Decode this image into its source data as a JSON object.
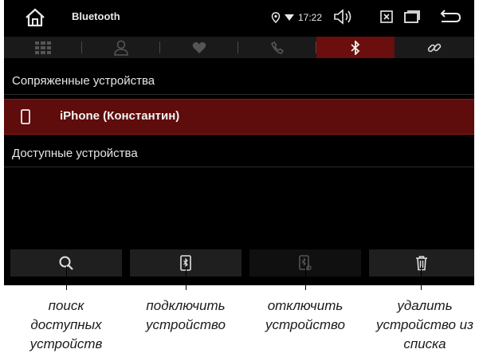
{
  "statusbar": {
    "title": "Bluetooth",
    "time": "17:22",
    "icons": [
      "home-icon",
      "location-icon",
      "wifi-icon",
      "volume-icon",
      "close-box-icon",
      "window-icon",
      "back-icon"
    ]
  },
  "tabs": [
    {
      "name": "keypad",
      "icon": "grid-icon",
      "active": false
    },
    {
      "name": "contacts",
      "icon": "person-icon",
      "active": false
    },
    {
      "name": "favorites",
      "icon": "heart-icon",
      "active": false
    },
    {
      "name": "calls",
      "icon": "phone-handset-icon",
      "active": false
    },
    {
      "name": "bluetooth",
      "icon": "bluetooth-icon",
      "active": true
    },
    {
      "name": "link",
      "icon": "link-icon",
      "active": false
    }
  ],
  "paired_header": "Сопряженные устройства",
  "paired_devices": [
    {
      "name": "iPhone (Константин)",
      "icon": "smartphone-icon",
      "selected": true
    }
  ],
  "available_header": "Доступные устройства",
  "actions": [
    {
      "name": "search",
      "icon": "search-icon",
      "enabled": true
    },
    {
      "name": "connect",
      "icon": "bluetooth-phone-icon",
      "enabled": true
    },
    {
      "name": "disconnect",
      "icon": "bluetooth-phone-disconnect-icon",
      "enabled": false
    },
    {
      "name": "delete",
      "icon": "trash-icon",
      "enabled": true
    }
  ],
  "captions": {
    "search": "поиск доступных устройств",
    "connect": "подключить устройство",
    "disconnect": "отключить устройство",
    "delete": "удалить устройство из списка"
  },
  "colors": {
    "active_tab": "#6a0e0e",
    "selected_row": "#5e0c0c",
    "text": "#e6e6e6"
  }
}
